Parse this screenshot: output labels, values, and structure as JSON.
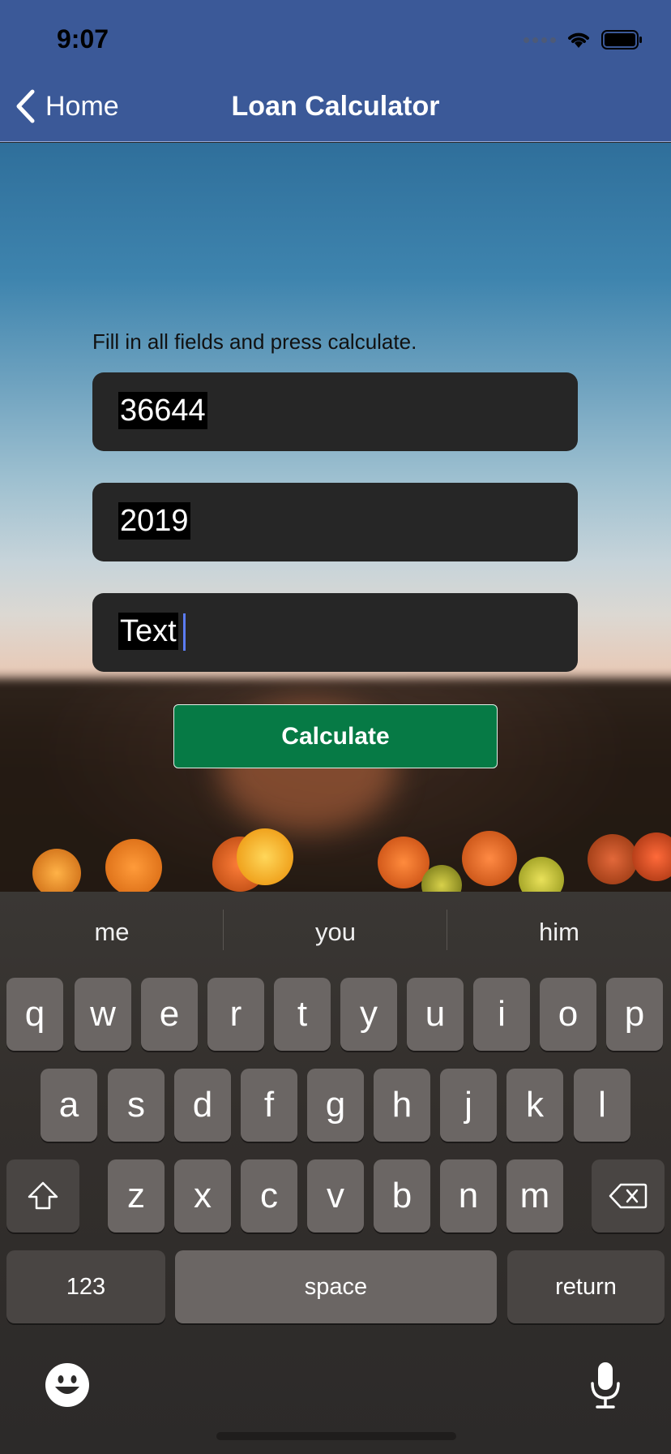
{
  "status": {
    "time": "9:07"
  },
  "nav": {
    "back_label": "Home",
    "title": "Loan Calculator"
  },
  "form": {
    "helper_text": "Fill in all fields and press calculate.",
    "fields": [
      {
        "value": "36644"
      },
      {
        "value": "2019"
      },
      {
        "value": "Text"
      }
    ],
    "calculate_label": "Calculate"
  },
  "keyboard": {
    "suggestions": [
      "me",
      "you",
      "him"
    ],
    "row1": [
      "q",
      "w",
      "e",
      "r",
      "t",
      "y",
      "u",
      "i",
      "o",
      "p"
    ],
    "row2": [
      "a",
      "s",
      "d",
      "f",
      "g",
      "h",
      "j",
      "k",
      "l"
    ],
    "row3": [
      "z",
      "x",
      "c",
      "v",
      "b",
      "n",
      "m"
    ],
    "numbers_label": "123",
    "space_label": "space",
    "return_label": "return",
    "shift_icon": "shift-icon",
    "delete_icon": "delete-icon",
    "emoji_icon": "emoji-icon",
    "mic_icon": "microphone-icon"
  },
  "colors": {
    "nav_bar": "#3b5998",
    "calculate_button": "#067a45",
    "field_bg": "#262626",
    "caret": "#5b7cf3"
  }
}
